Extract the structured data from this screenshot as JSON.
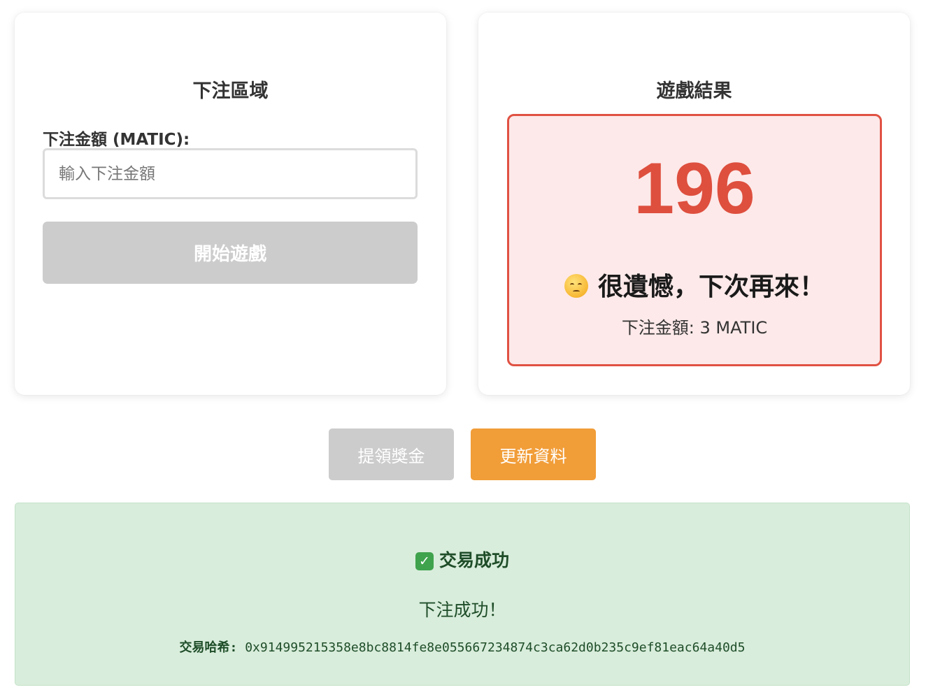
{
  "bet_panel": {
    "title": "下注區域",
    "amount_label": "下注金額 (MATIC):",
    "amount_value": "",
    "amount_placeholder": "輸入下注金額",
    "start_button_label": "開始遊戲"
  },
  "result_panel": {
    "title": "遊戲結果",
    "number": "196",
    "emoji": "pensive-face",
    "message": "很遺憾，下次再來！",
    "bet_amount_text": "下注金額: 3 MATIC",
    "status_color": "#e05243"
  },
  "actions": {
    "withdraw_label": "提領獎金",
    "refresh_label": "更新資料",
    "refresh_color": "#f19d38"
  },
  "transaction": {
    "icon": "check-mark-icon",
    "title": "交易成功",
    "message": "下注成功！",
    "hash_label": "交易哈希:",
    "hash_value": "0x914995215358e8bc8814fe8e055667234874c3ca62d0b235c9ef81eac64a40d5",
    "status_color": "#d9eddc"
  }
}
